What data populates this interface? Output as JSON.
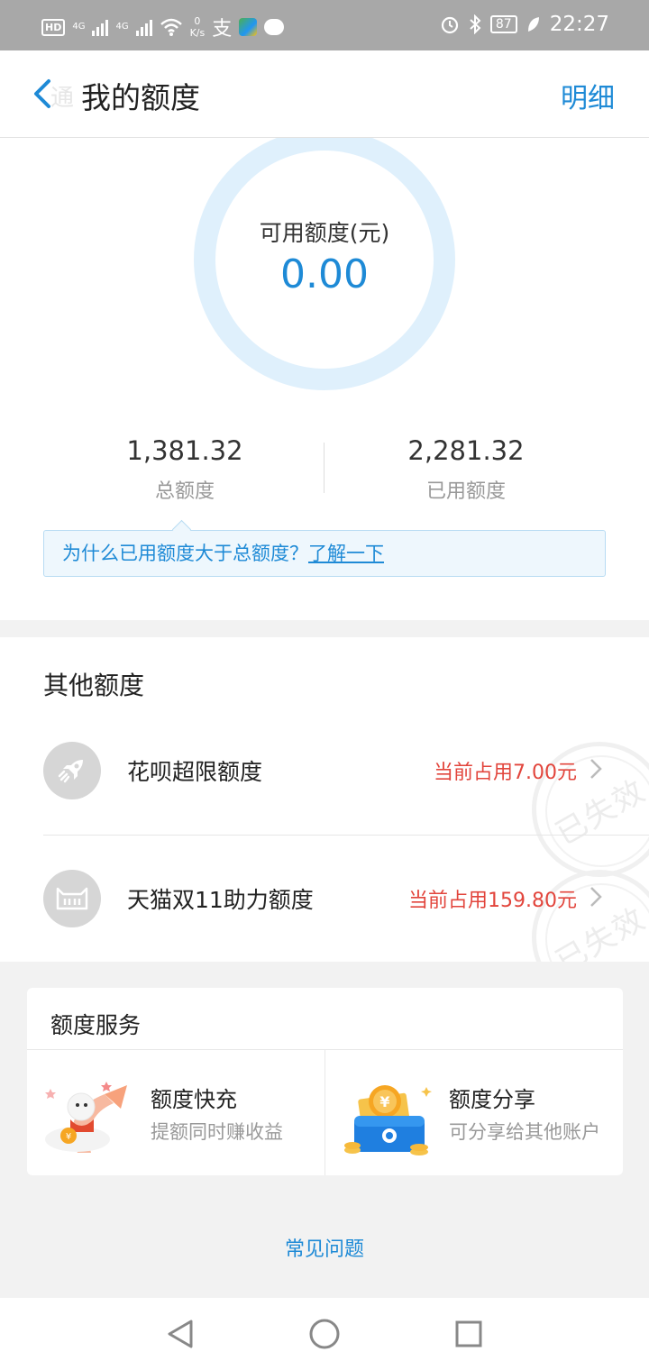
{
  "status_bar": {
    "hd": "HD",
    "net1": "4G",
    "net2": "4G",
    "speed_value": "0",
    "speed_unit": "K/s",
    "alipay_glyph": "支",
    "battery": "87",
    "time": "22:27"
  },
  "header": {
    "back_ghost": "通",
    "title": "我的额度",
    "detail_link": "明细"
  },
  "available": {
    "label": "可用额度(元)",
    "value": "0.00"
  },
  "stats": {
    "total_value": "1,381.32",
    "total_label": "总额度",
    "used_value": "2,281.32",
    "used_label": "已用额度"
  },
  "tip": {
    "text": "为什么已用额度大于总额度？",
    "link": "了解一下"
  },
  "other": {
    "title": "其他额度",
    "items": [
      {
        "name": "花呗超限额度",
        "value": "当前占用7.00元",
        "stamp": "已失效",
        "icon": "rocket-icon"
      },
      {
        "name": "天猫双11助力额度",
        "value": "当前占用159.80元",
        "stamp": "已失效",
        "icon": "tmall-1111-icon"
      }
    ]
  },
  "services": {
    "title": "额度服务",
    "items": [
      {
        "name": "额度快充",
        "desc": "提额同时赚收益",
        "icon": "quick-charge-illustration"
      },
      {
        "name": "额度分享",
        "desc": "可分享给其他账户",
        "icon": "wallet-share-illustration"
      }
    ]
  },
  "faq": "常见问题",
  "colors": {
    "accent": "#1e8ad6",
    "red": "#e2453c",
    "ring": "#dff0fc"
  }
}
